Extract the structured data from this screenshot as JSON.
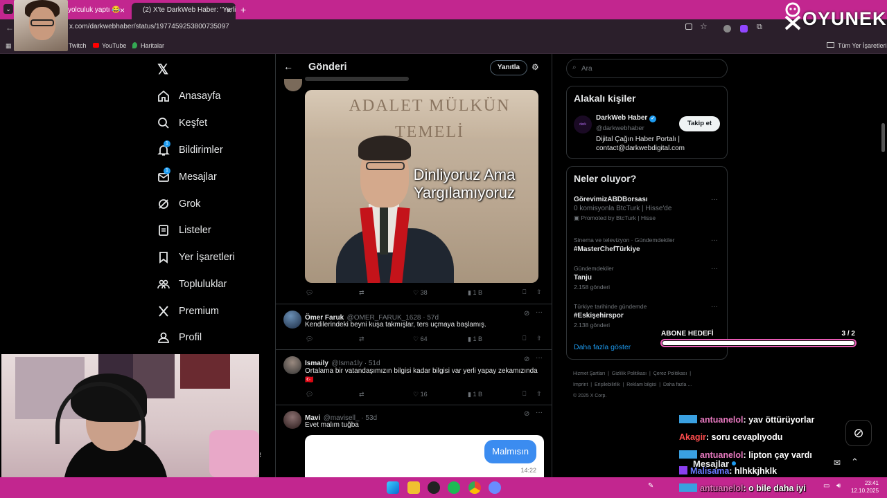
{
  "browser": {
    "tabs": [
      {
        "label": "yolculuk yaptı 😂"
      },
      {
        "label": "(2) X'te DarkWeb Haber: \"Yerli y"
      }
    ],
    "new_tab": "+",
    "url": "x.com/darkwebhaber/status/1977459253800735097",
    "bookmarks": [
      "Twitch",
      "YouTube",
      "Haritalar"
    ],
    "all_bookmarks": "Tüm Yer İşaretleri"
  },
  "stream": {
    "logo": "OYUNEKS",
    "goal_label": "ABONE HEDEFİ",
    "goal_value": "3 / 2"
  },
  "x_nav": [
    {
      "label": "Anasayfa",
      "icon": "home-icon"
    },
    {
      "label": "Keşfet",
      "icon": "search-icon"
    },
    {
      "label": "Bildirimler",
      "icon": "bell-icon",
      "badge": "1"
    },
    {
      "label": "Mesajlar",
      "icon": "mail-icon",
      "badge": "1"
    },
    {
      "label": "Grok",
      "icon": "grok-icon"
    },
    {
      "label": "Listeler",
      "icon": "list-icon"
    },
    {
      "label": "Yer İşaretleri",
      "icon": "bookmark-icon"
    },
    {
      "label": "Topluluklar",
      "icon": "communities-icon"
    },
    {
      "label": "Premium",
      "icon": "x-logo-icon"
    },
    {
      "label": "Profil",
      "icon": "profile-icon"
    }
  ],
  "post": {
    "header": "Gönderi",
    "reply_button": "Yanıtla",
    "image_caption_line1": "Dinliyoruz Ama",
    "image_caption_line2": "Yargılamıyoruz",
    "image_wall_text": "ADALET MÜLKÜN TEMELİ",
    "first_stats": {
      "likes": "38",
      "views": "1 B"
    }
  },
  "replies": [
    {
      "name": "Ömer Faruk",
      "handle": "@OMER_FARUK_1628 · 57d",
      "text": "Kendilerindeki beyni kuşa takmışlar, ters uçmaya başlamış.",
      "likes": "64",
      "views": "1 B"
    },
    {
      "name": "Ismaily",
      "handle": "@Isma1ly · 51d",
      "text": "Ortalama bir vatandaşımızın bilgisi kadar bilgisi var yerli yapay zekamızında 🇹🇷",
      "likes": "16",
      "views": "1 B"
    },
    {
      "name": "Mavi",
      "handle": "@mavisell_ · 53d",
      "text": "Evet malım tuğba",
      "bubble": "Malmısın",
      "bubble_time": "14:22"
    }
  ],
  "right": {
    "search_placeholder": "Ara",
    "related_title": "Alakalı kişiler",
    "person_name": "DarkWeb Haber",
    "person_handle": "@darkwebhaber",
    "person_bio_line1": "Dijital Çağın Haber Portalı |",
    "person_bio_line2": "contact@darkwebdigital.com",
    "follow_button": "Takip et",
    "trends_title": "Neler oluyor?",
    "trends": [
      {
        "meta": "",
        "title": "GörevimizABDBorsası",
        "sub": "0 komisyonla BtcTurk | Hisse'de",
        "promo": "Promoted by BtcTurk | Hisse"
      },
      {
        "meta": "Sinema ve televizyon · Gündemdekiler",
        "title": "#MasterChefTürkiye",
        "sub": ""
      },
      {
        "meta": "Gündemdekiler",
        "title": "Tanju",
        "sub": "2.158 gönderi"
      },
      {
        "meta": "Türkiye tarihinde gündemde",
        "title": "#Eskişehirspor",
        "sub": "2.138 gönderi"
      }
    ],
    "show_more": "Daha fazla göster",
    "footer_line1": [
      "Hizmet Şartları",
      "Gizlilik Politikası",
      "Çerez Politikası"
    ],
    "footer_line2": [
      "Imprint",
      "Erişilebilirlik",
      "Reklam bilgisi",
      "Daha fazla ..."
    ],
    "copyright": "© 2025 X Corp."
  },
  "chat": [
    {
      "user": "antuanelol",
      "msg": ": yav öttürüyorlar",
      "color": "#e879c0"
    },
    {
      "user": "Akagir",
      "msg": ": soru cevaplıyodu",
      "color": "#ff4d4d"
    },
    {
      "user": "antuanelol",
      "msg": ": lipton çay vardı",
      "color": "#e879c0"
    },
    {
      "user": "Malisama",
      "msg": ": hlhkkjhklk",
      "color": "#6a7bff"
    },
    {
      "user": "antuanelol",
      "msg": ": o bile daha iyi",
      "color": "#e879c0"
    }
  ],
  "messages_drawer": "Mesajlar",
  "clock": {
    "time": "23:41",
    "date": "12.10.2025"
  },
  "colors": {
    "accent": "#1d9bf0",
    "stream_pink": "#c2268f"
  }
}
